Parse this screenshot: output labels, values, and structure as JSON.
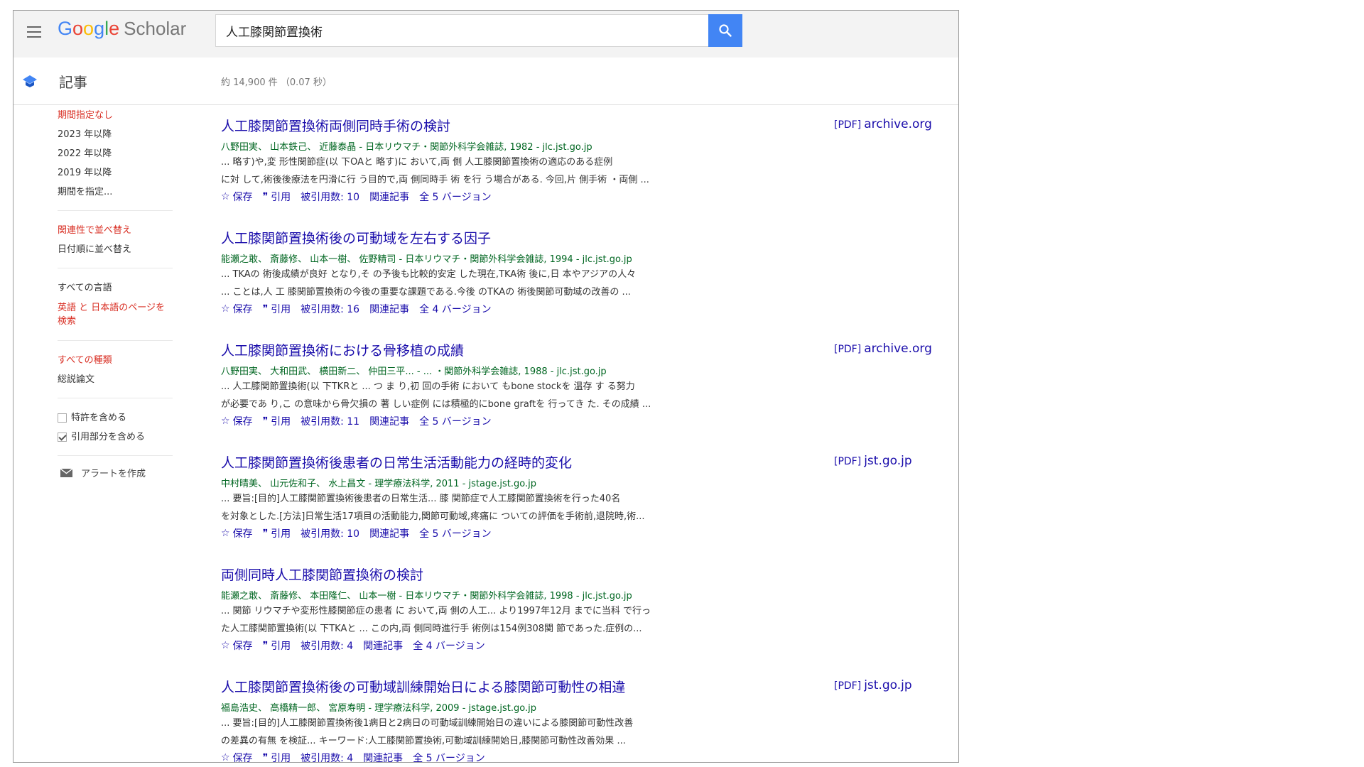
{
  "header": {
    "logo_google": [
      "G",
      "o",
      "o",
      "g",
      "l",
      "e"
    ],
    "logo_scholar": "Scholar",
    "search_query": "人工膝関節置換術"
  },
  "subheader": {
    "section": "記事",
    "stats": "約 14,900 件 （0.07 秒）"
  },
  "sidebar": {
    "time_filters": [
      "期間指定なし",
      "2023 年以降",
      "2022 年以降",
      "2019 年以降",
      "期間を指定..."
    ],
    "sort": [
      "関連性で並べ替え",
      "日付順に並べ替え"
    ],
    "language": [
      "すべての言語",
      "英語 と 日本語のページを検索"
    ],
    "type": [
      "すべての種類",
      "総説論文"
    ],
    "include_patents": "特許を含める",
    "include_citations": "引用部分を含める",
    "create_alert": "アラートを作成"
  },
  "actions": {
    "save": "保存",
    "cite": "引用"
  },
  "results": [
    {
      "title": "人工膝関節置換術両側同時手術の検討",
      "meta": "八野田実、 山本鉄己、 近藤泰晶 - 日本リウマチ・関節外科学会雑誌, 1982 - jlc.jst.go.jp",
      "snippet1": "... 略す)や,変 形性関節症(以 下OAと 略す)に おいて,両 側 人工膝関節置換術の適応のある症例",
      "snippet2": "に対 して,術後後療法を円滑に行 う目的で,両 側同時手 術 を行 う場合がある. 今回,片 側手術 ・両側 ...",
      "cited": "被引用数: 10",
      "related": "関連記事",
      "versions": "全 5 バージョン",
      "pdf_tag": "[PDF]",
      "pdf_source": "archive.org"
    },
    {
      "title": "人工膝関節置換術後の可動域を左右する因子",
      "meta": "能瀬之敢、 斎藤修、 山本一樹、 佐野精司 - 日本リウマチ・関節外科学会雑誌, 1994 - jlc.jst.go.jp",
      "snippet1": "... TKAの 術後成績が良好 となり,そ の予後も比較的安定 した現在,TKA術 後に,日 本やアジアの人々",
      "snippet2": "... ことは,人 工 膝関節置換術の今後の重要な課題である.今後 のTKAの 術後関節可動域の改善の ...",
      "cited": "被引用数: 16",
      "related": "関連記事",
      "versions": "全 4 バージョン",
      "pdf_tag": "",
      "pdf_source": ""
    },
    {
      "title": "人工膝関節置換術における骨移植の成績",
      "meta": "八野田実、 大和田武、 横田新二、 仲田三平... - ... ・関節外科学会雑誌, 1988 - jlc.jst.go.jp",
      "snippet1": "... 人工膝関節置換術(以 下TKRと ... つ ま り,初 回の手術 において もbone stockを 温存 す る努力",
      "snippet2": "が必要であ り,こ の意味から骨欠損の 著 しい症例 には積極的にbone graftを 行ってき た. その成績 ...",
      "cited": "被引用数: 11",
      "related": "関連記事",
      "versions": "全 5 バージョン",
      "pdf_tag": "[PDF]",
      "pdf_source": "archive.org"
    },
    {
      "title": "人工膝関節置換術後患者の日常生活活動能力の経時的変化",
      "meta": "中村晴美、 山元佐和子、 水上昌文 - 理学療法科学, 2011 - jstage.jst.go.jp",
      "snippet1": "... 要旨:[目的]人工膝関節置換術後患者の日常生活... 膝 関節症で人工膝関節置換術を行った40名",
      "snippet2": "を対象とした.[方法]日常生活17項目の活動能力,関節可動域,疼痛に ついての評価を手術前,退院時,術...",
      "cited": "被引用数: 10",
      "related": "関連記事",
      "versions": "全 5 バージョン",
      "pdf_tag": "[PDF]",
      "pdf_source": "jst.go.jp"
    },
    {
      "title": "両側同時人工膝関節置換術の検討",
      "meta": "能瀬之敢、 斎藤修、 本田隆仁、 山本一樹 - 日本リウマチ・関節外科学会雑誌, 1998 - jlc.jst.go.jp",
      "snippet1": "... 関節 リウマチや変形性膝関節症の患者 に おいて,両 側の人工... より1997年12月 までに当科 で行っ",
      "snippet2": "た人工膝関節置換術(以 下TKAと ... この内,両 側同時進行手 術例は154例308関 節であった.症例の...",
      "cited": "被引用数: 4",
      "related": "関連記事",
      "versions": "全 4 バージョン",
      "pdf_tag": "",
      "pdf_source": ""
    },
    {
      "title": "人工膝関節置換術後の可動域訓練開始日による膝関節可動性の相違",
      "meta": "福島浩史、 高橋精一郎、 宮原寿明 - 理学療法科学, 2009 - jstage.jst.go.jp",
      "snippet1": "... 要旨:[目的]人工膝関節置換術後1病日と2病日の可動域訓練開始日の違いによる膝関節可動性改善",
      "snippet2": "の差異の有無 を検証... キーワード:人工膝関節置換術,可動域訓練開始日,膝関節可動性改善効果 ...",
      "cited": "被引用数: 4",
      "related": "関連記事",
      "versions": "全 5 バージョン",
      "pdf_tag": "[PDF]",
      "pdf_source": "jst.go.jp"
    }
  ]
}
